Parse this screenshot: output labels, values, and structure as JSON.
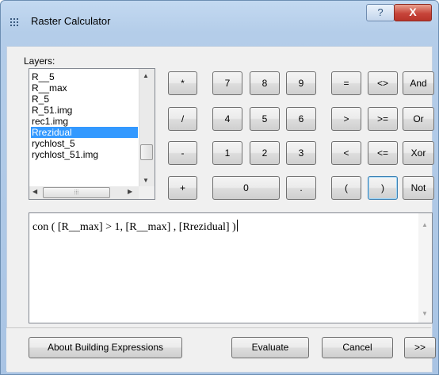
{
  "window": {
    "title": "Raster Calculator",
    "help_label": "?",
    "close_label": "X"
  },
  "layers": {
    "label": "Layers:",
    "items": [
      {
        "name": "R__5",
        "selected": false
      },
      {
        "name": "R__max",
        "selected": false
      },
      {
        "name": "R_5",
        "selected": false
      },
      {
        "name": "R_51.img",
        "selected": false
      },
      {
        "name": "rec1.img",
        "selected": false
      },
      {
        "name": "Rrezidual",
        "selected": true
      },
      {
        "name": "rychlost_5",
        "selected": false
      },
      {
        "name": "rychlost_51.img",
        "selected": false
      }
    ]
  },
  "keypad": {
    "ops_col": [
      "*",
      "/",
      "-",
      "+"
    ],
    "digits_row1": [
      "7",
      "8",
      "9"
    ],
    "digits_row2": [
      "4",
      "5",
      "6"
    ],
    "digits_row3": [
      "1",
      "2",
      "3"
    ],
    "zero": "0",
    "dot": ".",
    "cmp_row1": [
      "=",
      "<>"
    ],
    "cmp_row2": [
      ">",
      ">="
    ],
    "cmp_row3": [
      "<",
      "<="
    ],
    "paren": [
      "(",
      ")"
    ],
    "logic": [
      "And",
      "Or",
      "Xor",
      "Not"
    ]
  },
  "expression": {
    "value": "con ( [R__max] > 1, [R__max] , [Rrezidual] )"
  },
  "footer": {
    "about_label": "About Building Expressions",
    "evaluate_label": "Evaluate",
    "cancel_label": "Cancel",
    "more_label": ">>"
  },
  "colors": {
    "selection": "#3399ff",
    "close_button": "#c7453a",
    "title_gradient": "#c3d9f1"
  }
}
